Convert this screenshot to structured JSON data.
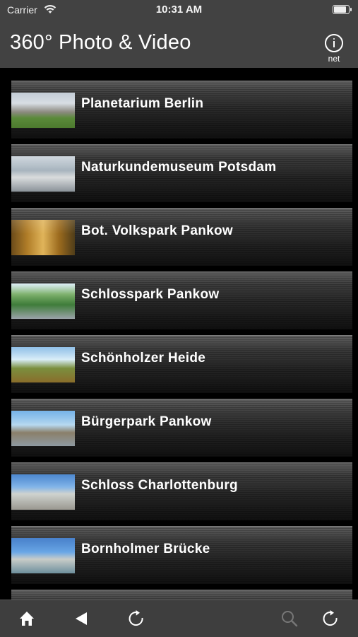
{
  "status_bar": {
    "carrier": "Carrier",
    "time": "10:31 AM",
    "battery_level": 0.92
  },
  "nav": {
    "title": "360° Photo & Video",
    "info_label": "net"
  },
  "list": {
    "items": [
      {
        "label": "Planetarium Berlin",
        "thumb": "planetarium-photo"
      },
      {
        "label": "Naturkundemuseum Potsdam",
        "thumb": "birds-photo"
      },
      {
        "label": "Bot. Volkspark Pankow",
        "thumb": "autumn-park-photo"
      },
      {
        "label": "Schlosspark Pankow",
        "thumb": "park-panorama-photo"
      },
      {
        "label": "Schönholzer Heide",
        "thumb": "heath-panorama-photo"
      },
      {
        "label": "Bürgerpark Pankow",
        "thumb": "gate-panorama-photo"
      },
      {
        "label": "Schloss Charlottenburg",
        "thumb": "palace-panorama-photo"
      },
      {
        "label": "Bornholmer Brücke",
        "thumb": "bridge-panorama-photo"
      }
    ]
  },
  "toolbar": {
    "icons": [
      "home-icon",
      "back-arrow-icon",
      "reload-icon",
      "search-icon",
      "refresh-icon"
    ]
  },
  "colors": {
    "bar_background": "#424242",
    "list_background": "#000000",
    "text": "#ffffff"
  }
}
